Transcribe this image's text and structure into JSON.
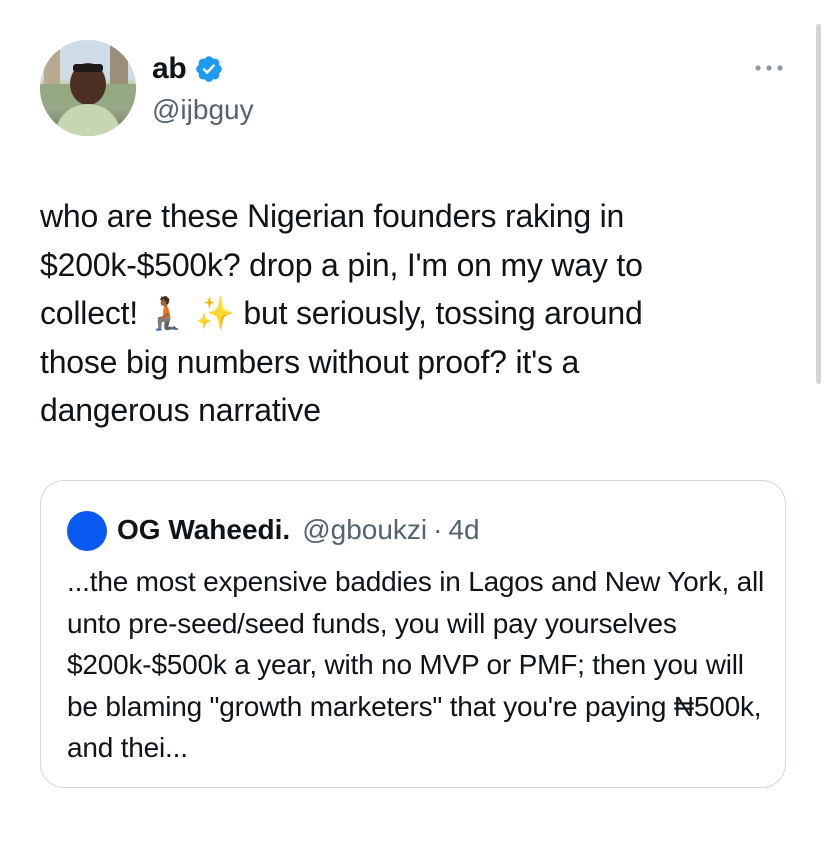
{
  "author": {
    "display_name": "ab",
    "handle": "@ijbguy",
    "verified": true,
    "verified_color": "#1d9bf0"
  },
  "tweet": {
    "line1": "who are these Nigerian founders raking in",
    "line2": "$200k-$500k? drop a pin, I'm on my way to",
    "line3_before": "collect! ",
    "emoji_1": "🧎🏾",
    "emoji_2": "✨",
    "line3_after": " but seriously, tossing around",
    "line4": "those big numbers without proof? it's a",
    "line5": "dangerous narrative"
  },
  "quote": {
    "display_name": "OG Waheedi.",
    "handle": "@gboukzi",
    "separator": "·",
    "time": "4d",
    "avatar_color": "#0a59f0",
    "text": "...the most expensive baddies in Lagos and New York, all unto pre-seed/seed funds, you will pay yourselves $200k-$500k a year, with no MVP or PMF; then you will be blaming \"growth marketers\" that you're paying ₦500k, and thei..."
  },
  "icons": {
    "more": "more-horizontal-icon",
    "verified": "verified-badge-icon"
  }
}
